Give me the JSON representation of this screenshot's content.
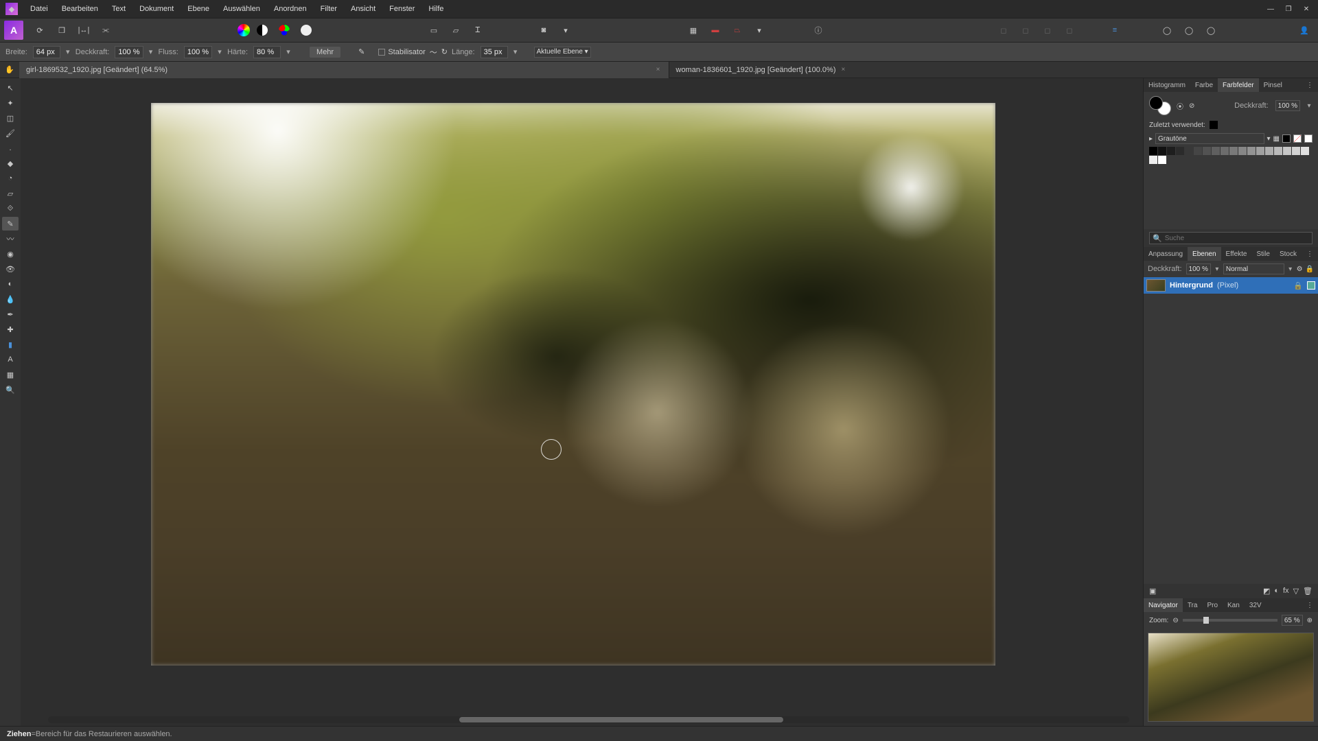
{
  "menu": [
    "Datei",
    "Bearbeiten",
    "Text",
    "Dokument",
    "Ebene",
    "Auswählen",
    "Anordnen",
    "Filter",
    "Ansicht",
    "Fenster",
    "Hilfe"
  ],
  "ctx": {
    "width_label": "Breite:",
    "width_val": "64 px",
    "opacity_label": "Deckkraft:",
    "opacity_val": "100 %",
    "flow_label": "Fluss:",
    "flow_val": "100 %",
    "hardness_label": "Härte:",
    "hardness_val": "80 %",
    "more": "Mehr",
    "stabilizer": "Stabilisator",
    "length_label": "Länge:",
    "length_val": "35 px",
    "layer_scope": "Aktuelle Ebene"
  },
  "tabs": [
    {
      "label": "girl-1869532_1920.jpg [Geändert] (64.5%)",
      "active": true
    },
    {
      "label": "woman-1836601_1920.jpg [Geändert] (100.0%)",
      "active": false
    }
  ],
  "right_tabs_top": [
    "Histogramm",
    "Farbe",
    "Farbfelder",
    "Pinsel"
  ],
  "right_tabs_top_active": "Farbfelder",
  "swatch_panel": {
    "opacity_label": "Deckkraft:",
    "opacity_val": "100 %",
    "recent_label": "Zuletzt verwendet:",
    "palette_name": "Grautöne"
  },
  "search_placeholder": "Suche",
  "right_tabs_mid": [
    "Anpassung",
    "Ebenen",
    "Effekte",
    "Stile",
    "Stock"
  ],
  "right_tabs_mid_active": "Ebenen",
  "layers_panel": {
    "opacity_label": "Deckkraft:",
    "opacity_val": "100 %",
    "blend_mode": "Normal",
    "layer_name": "Hintergrund",
    "layer_type": "(Pixel)"
  },
  "right_tabs_bot": [
    "Navigator",
    "Tra",
    "Pro",
    "Kan",
    "32V"
  ],
  "right_tabs_bot_active": "Navigator",
  "navigator": {
    "zoom_label": "Zoom:",
    "zoom_val": "65 %"
  },
  "status": {
    "action": "Ziehen",
    "sep": " = ",
    "hint": "Bereich für das Restaurieren auswählen."
  },
  "grayscale_swatches": [
    "#000000",
    "#111111",
    "#1e1e1e",
    "#2b2b2b",
    "#383838",
    "#454545",
    "#525252",
    "#5f5f5f",
    "#6c6c6c",
    "#797979",
    "#868686",
    "#939393",
    "#a0a0a0",
    "#adadad",
    "#bababa",
    "#c7c7c7",
    "#d4d4d4",
    "#e1e1e1",
    "#eeeeee",
    "#ffffff"
  ]
}
